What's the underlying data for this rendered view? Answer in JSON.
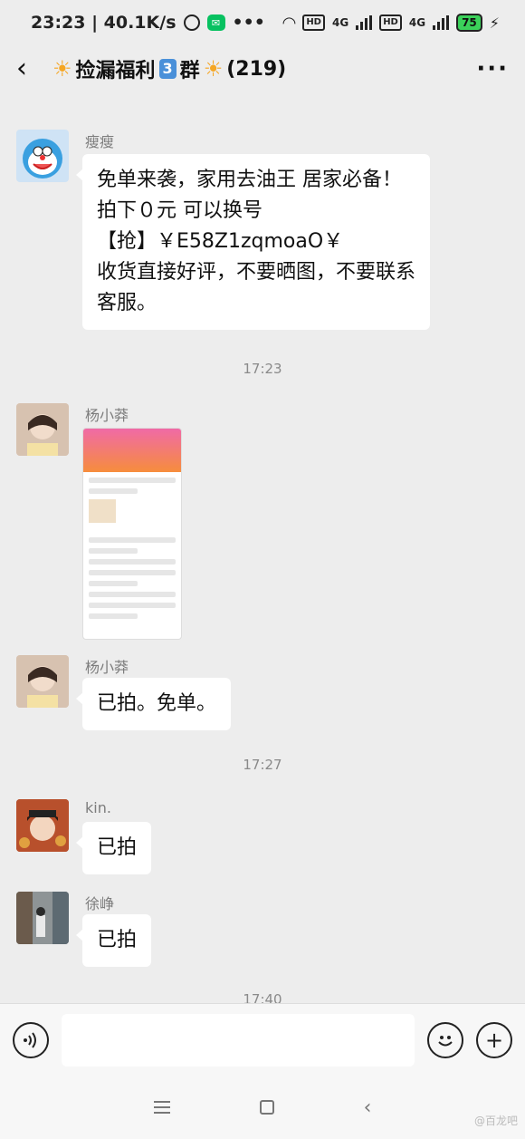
{
  "status_bar": {
    "time_speed": "23:23 | 40.1K/s",
    "dots": "•••",
    "hd1": "HD",
    "net1": "4G",
    "hd2": "HD",
    "net2": "4G",
    "battery": "75"
  },
  "header": {
    "back_icon": "chevron-left",
    "title_prefix_icon": "sun",
    "title": "捡漏福利",
    "title_badge": "3",
    "title_suffix": "群",
    "title_suffix_icon": "sun",
    "member_count": "(219)",
    "more_icon": "more-horizontal"
  },
  "messages": [
    {
      "sender": "瘦瘦",
      "lines": [
        "免单来袭，家用去油王  居家必备！",
        "拍下０元  可以换号",
        "【抢】￥E58Z1zqmoaO￥",
        "收货直接好评，不要晒图，不要联系",
        "客服。"
      ]
    },
    {
      "timestamp": "17:23"
    },
    {
      "sender": "杨小莽",
      "type": "image"
    },
    {
      "sender": "杨小莽",
      "lines": [
        "已拍。免单。"
      ]
    },
    {
      "timestamp": "17:27"
    },
    {
      "sender": "kin.",
      "lines": [
        "已拍"
      ]
    },
    {
      "sender": "徐峥",
      "lines": [
        "已拍"
      ]
    },
    {
      "timestamp": "17:40"
    }
  ],
  "input_bar": {
    "voice_icon": "voice",
    "emoji_icon": "emoji",
    "add_icon": "plus",
    "input_value": ""
  },
  "nav_bar": {
    "menu_icon": "menu",
    "home_icon": "square",
    "back_icon": "chevron-left"
  },
  "watermark": "@百龙吧"
}
